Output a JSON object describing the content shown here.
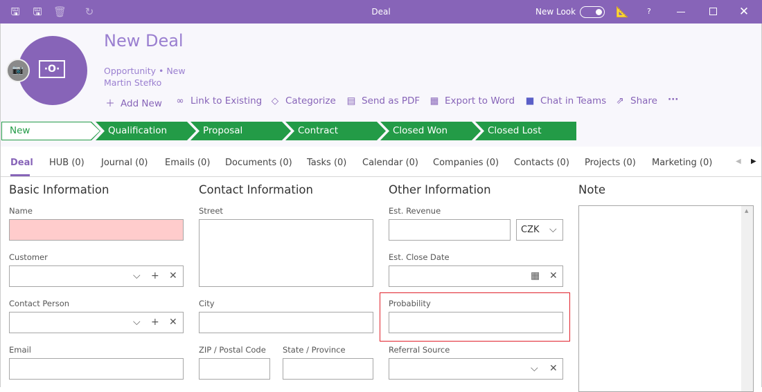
{
  "window": {
    "title": "Deal",
    "new_look_label": "New Look",
    "new_look_on": true,
    "help": "?"
  },
  "colors": {
    "accent": "#8764b8",
    "pipeline": "#239b47",
    "required": "#ffcccc",
    "highlight": "#e0202a"
  },
  "record": {
    "title": "New Deal",
    "subtitle": "Opportunity • New",
    "owner": "Martin Stefko"
  },
  "actions": [
    {
      "icon": "plus-icon",
      "label": "Add New"
    },
    {
      "icon": "link-icon",
      "label": "Link to Existing"
    },
    {
      "icon": "tag-icon",
      "label": "Categorize"
    },
    {
      "icon": "pdf-icon",
      "label": "Send as PDF"
    },
    {
      "icon": "word-icon",
      "label": "Export to Word"
    },
    {
      "icon": "teams-icon",
      "label": "Chat in Teams"
    },
    {
      "icon": "share-icon",
      "label": "Share"
    }
  ],
  "pipeline": [
    "New",
    "Qualification",
    "Proposal",
    "Contract",
    "Closed Won",
    "Closed Lost"
  ],
  "pipeline_current": "New",
  "tabs": [
    "Deal",
    "HUB (0)",
    "Journal (0)",
    "Emails (0)",
    "Documents (0)",
    "Tasks (0)",
    "Calendar (0)",
    "Companies (0)",
    "Contacts (0)",
    "Projects (0)",
    "Marketing (0)"
  ],
  "active_tab": "Deal",
  "sections": {
    "basic": {
      "title": "Basic Information",
      "name": "Name",
      "customer": "Customer",
      "contact_person": "Contact Person",
      "email": "Email"
    },
    "contact": {
      "title": "Contact Information",
      "street": "Street",
      "city": "City",
      "zip": "ZIP / Postal Code",
      "state": "State / Province"
    },
    "other": {
      "title": "Other Information",
      "revenue": "Est. Revenue",
      "currency": "CZK",
      "close_date": "Est. Close Date",
      "probability": "Probability",
      "referral": "Referral Source"
    },
    "note": {
      "title": "Note"
    }
  }
}
